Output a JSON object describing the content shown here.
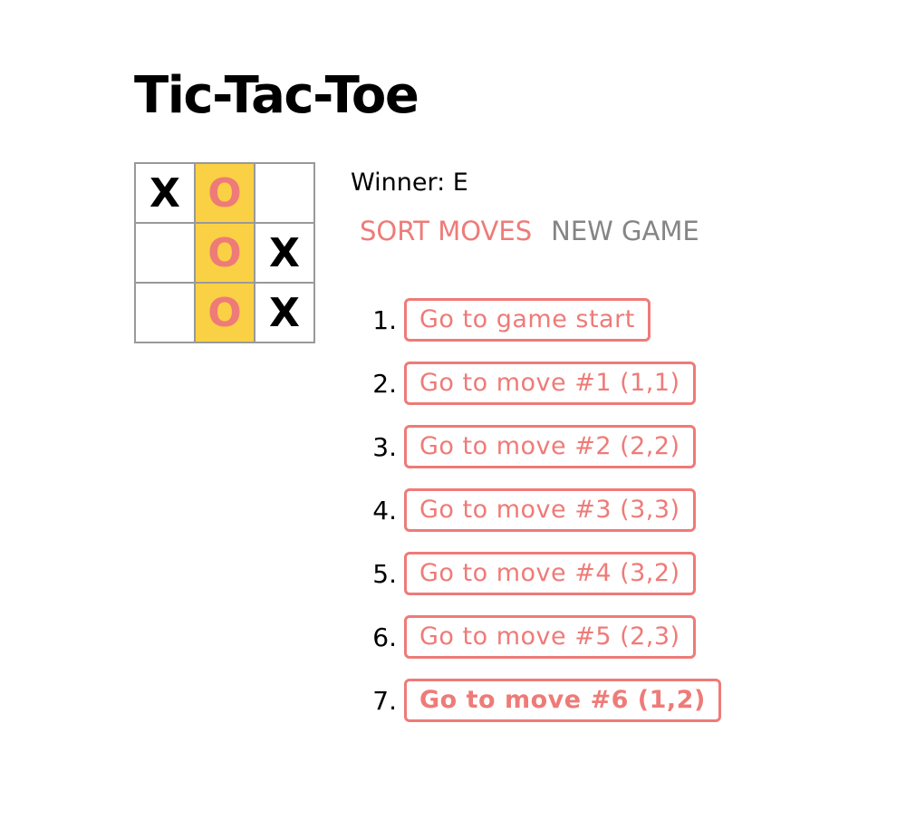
{
  "title": "Tic-Tac-Toe",
  "colors": {
    "accent": "#ee7b78",
    "win_highlight": "#fad144",
    "muted": "#858585",
    "border": "#999999"
  },
  "board": {
    "cells": [
      "X",
      "O",
      "",
      "",
      "O",
      "X",
      "",
      "O",
      "X"
    ],
    "winning_cells": [
      1,
      4,
      7
    ]
  },
  "status": "Winner: E",
  "controls": {
    "sort_label": "SORT MOVES",
    "new_game_label": "NEW GAME"
  },
  "moves": [
    {
      "num": "1.",
      "label": "Go to game start",
      "current": false
    },
    {
      "num": "2.",
      "label": "Go to move #1 (1,1)",
      "current": false
    },
    {
      "num": "3.",
      "label": "Go to move #2 (2,2)",
      "current": false
    },
    {
      "num": "4.",
      "label": "Go to move #3 (3,3)",
      "current": false
    },
    {
      "num": "5.",
      "label": "Go to move #4 (3,2)",
      "current": false
    },
    {
      "num": "6.",
      "label": "Go to move #5 (2,3)",
      "current": false
    },
    {
      "num": "7.",
      "label": "Go to move #6 (1,2)",
      "current": true
    }
  ]
}
